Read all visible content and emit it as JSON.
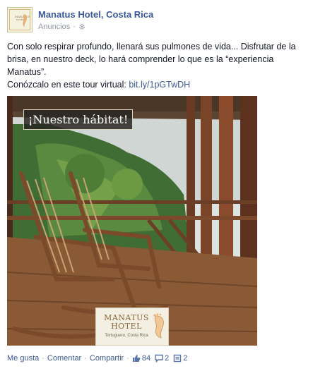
{
  "post": {
    "page_name": "Manatus Hotel, Costa Rica",
    "meta": {
      "label": "Anuncios",
      "separator": "·",
      "settings_icon": "gear-icon"
    },
    "message": {
      "line1": "Con solo respirar profundo, llenará sus pulmones de vida... Disfrutar de la brisa, en nuestro deck, lo hará comprender lo que es la “experiencia Manatus”.",
      "line2_prefix": "Conózcalo en este tour virtual: ",
      "link_text": "bit.ly/1pGTwDH"
    },
    "photo": {
      "banner_text": "¡Nuestro hábitat!",
      "logo_name_line1": "MANATUS",
      "logo_name_line2": "HOTEL",
      "logo_sub": "Tortuguero, Costa Rica"
    },
    "actions": {
      "like": "Me gusta",
      "comment": "Comentar",
      "share": "Compartir",
      "likes_count": "84",
      "comments_count": "2",
      "shares_count": "2",
      "separator": "·"
    }
  },
  "colors": {
    "link": "#3b5998",
    "meta": "#9197a3",
    "text": "#141823"
  }
}
